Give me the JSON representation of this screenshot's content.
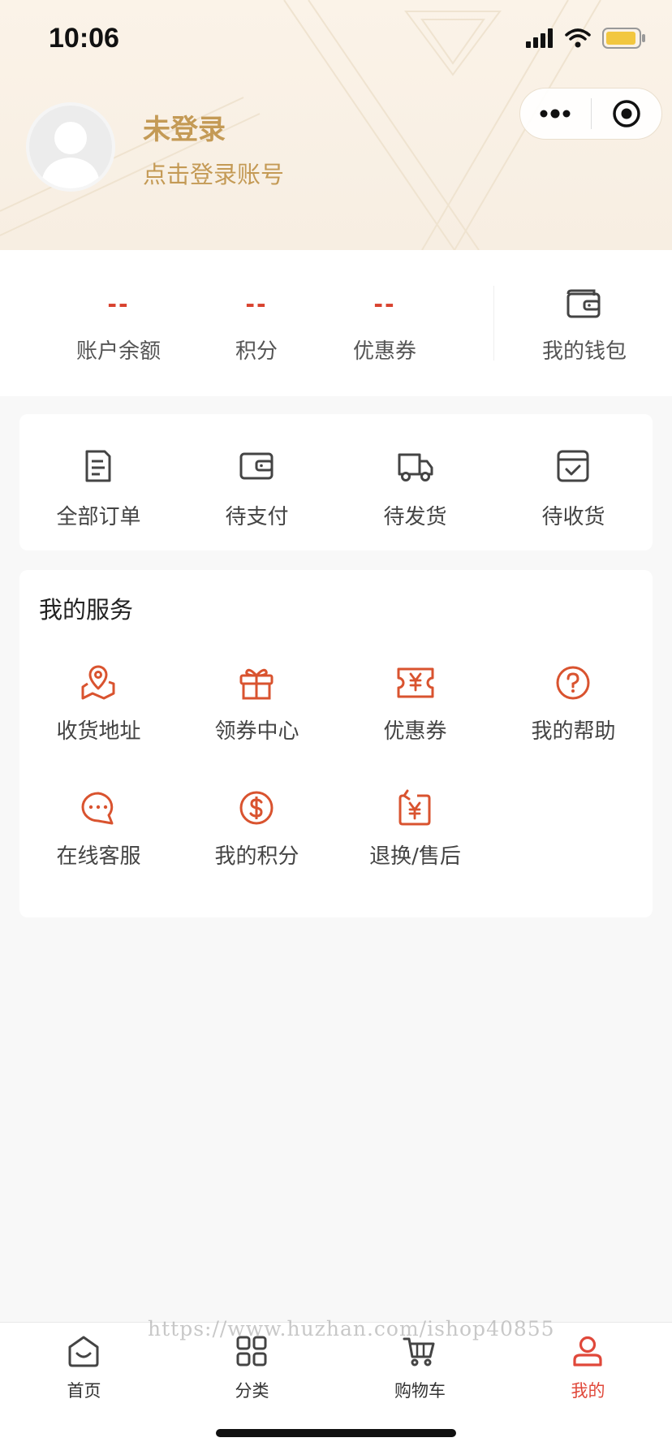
{
  "status_bar": {
    "time": "10:06"
  },
  "profile": {
    "name": "未登录",
    "subtitle": "点击登录账号"
  },
  "wallet": {
    "items": [
      {
        "value": "--",
        "label": "账户余额"
      },
      {
        "value": "--",
        "label": "积分"
      },
      {
        "value": "--",
        "label": "优惠券"
      }
    ],
    "purse_label": "我的钱包"
  },
  "orders": {
    "items": [
      {
        "label": "全部订单",
        "icon": "document-icon"
      },
      {
        "label": "待支付",
        "icon": "wallet-icon"
      },
      {
        "label": "待发货",
        "icon": "truck-icon"
      },
      {
        "label": "待收货",
        "icon": "box-check-icon"
      }
    ]
  },
  "services": {
    "title": "我的服务",
    "items": [
      {
        "label": "收货地址",
        "icon": "map-pin-icon"
      },
      {
        "label": "领券中心",
        "icon": "gift-icon"
      },
      {
        "label": "优惠券",
        "icon": "coupon-icon"
      },
      {
        "label": "我的帮助",
        "icon": "help-icon"
      },
      {
        "label": "在线客服",
        "icon": "chat-icon"
      },
      {
        "label": "我的积分",
        "icon": "dollar-icon"
      },
      {
        "label": "退换/售后",
        "icon": "return-icon"
      }
    ]
  },
  "tabbar": {
    "tabs": [
      {
        "label": "首页",
        "icon": "home-icon"
      },
      {
        "label": "分类",
        "icon": "grid-icon"
      },
      {
        "label": "购物车",
        "icon": "cart-icon"
      },
      {
        "label": "我的",
        "icon": "user-icon"
      }
    ],
    "active_index": 3
  },
  "watermark": "https://www.huzhan.com/ishop40855",
  "colors": {
    "accent": "#d9432f",
    "gold": "#c49a55",
    "active_tab": "#e0483a"
  }
}
